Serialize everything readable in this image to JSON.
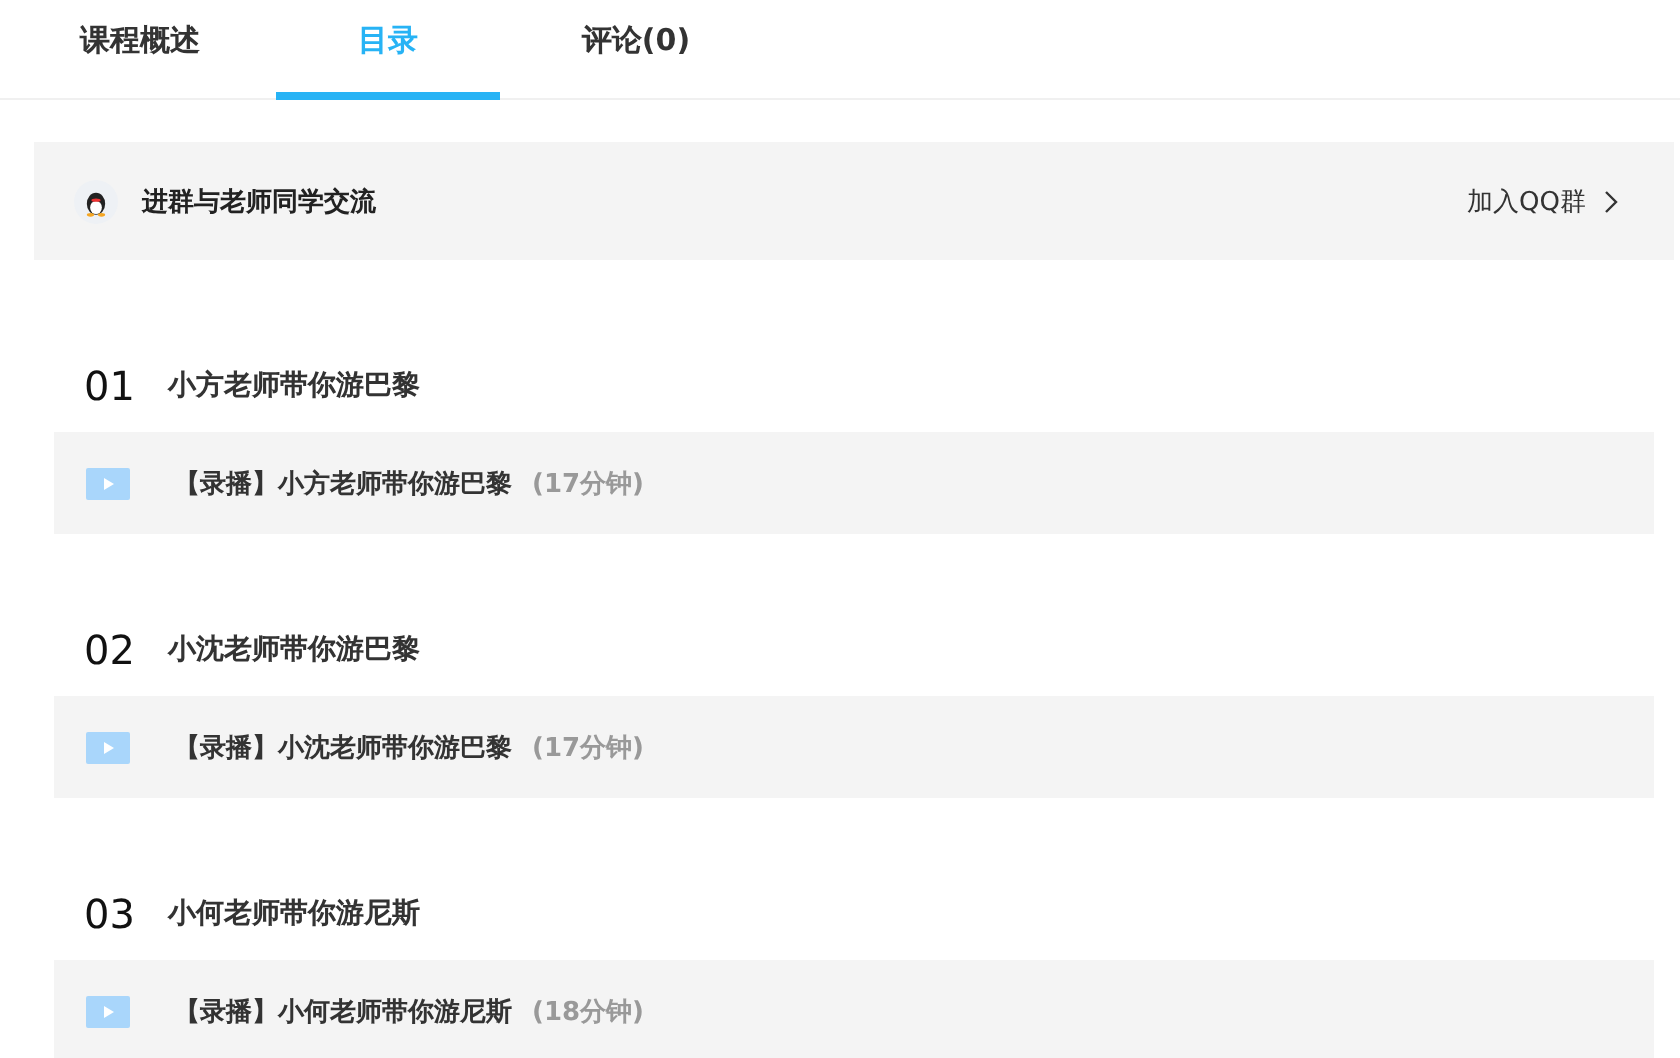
{
  "tabs": [
    {
      "label": "课程概述",
      "selected": false
    },
    {
      "label": "目录",
      "selected": true
    },
    {
      "label": "评论(0)",
      "selected": false
    }
  ],
  "group_banner": {
    "text": "进群与老师同学交流",
    "link": "加入QQ群"
  },
  "chapters": [
    {
      "number": "01",
      "title": "小方老师带你游巴黎",
      "lessons": [
        {
          "title": "【录播】小方老师带你游巴黎",
          "duration": "(17分钟)"
        }
      ]
    },
    {
      "number": "02",
      "title": "小沈老师带你游巴黎",
      "lessons": [
        {
          "title": "【录播】小沈老师带你游巴黎",
          "duration": "(17分钟)"
        }
      ]
    },
    {
      "number": "03",
      "title": "小何老师带你游尼斯",
      "lessons": [
        {
          "title": "【录播】小何老师带你游尼斯",
          "duration": "(18分钟)"
        }
      ]
    }
  ]
}
